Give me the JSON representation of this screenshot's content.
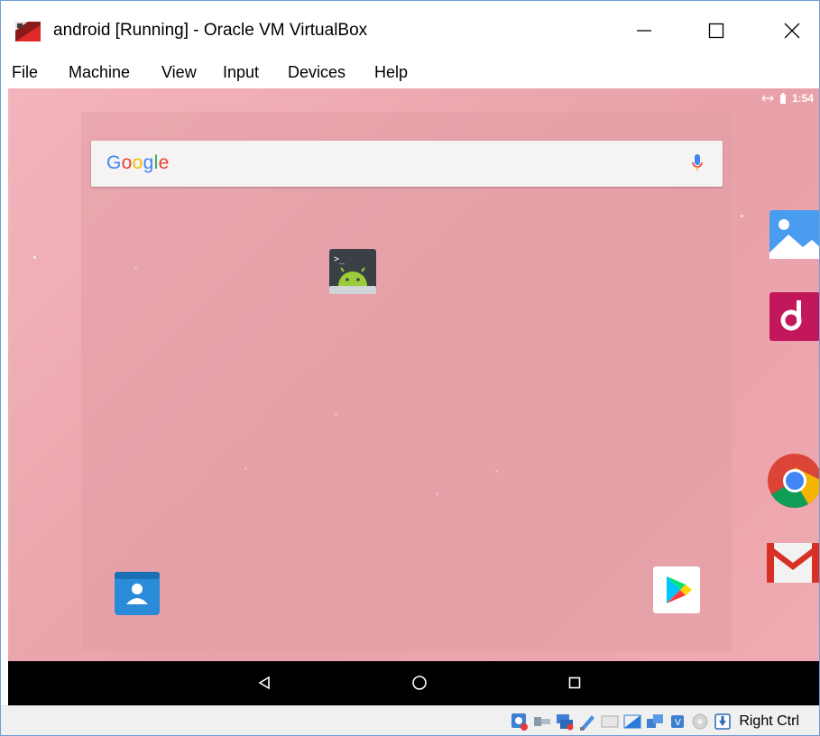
{
  "window": {
    "title": "android [Running] - Oracle VM VirtualBox",
    "minimize_glyph": "—",
    "maximize_glyph": "☐",
    "close_glyph": "✕"
  },
  "menu": {
    "items": [
      "File",
      "Machine",
      "View",
      "Input",
      "Devices",
      "Help"
    ]
  },
  "android": {
    "status_time": "1:54",
    "search_logo": "Google",
    "home_icons": [
      "terminal-emulator-icon",
      "contacts-icon",
      "play-store-icon"
    ],
    "side_icons": [
      "gallery-icon",
      "music-icon",
      "chrome-icon",
      "gmail-icon"
    ],
    "nav": [
      "back",
      "home",
      "recents"
    ]
  },
  "statusbar": {
    "host_key": "Right Ctrl",
    "tray_icons": [
      "optical-drive-icon",
      "usb-icon",
      "network-icon",
      "shared-folders-icon",
      "display-icon",
      "video-capture-icon",
      "mouse-integration-icon",
      "cpu-icon",
      "settings-icon",
      "host-key-arrow-icon"
    ]
  },
  "colors": {
    "accent_blue": "#4285f4",
    "google_red": "#ea4335",
    "google_yellow": "#fbbc05",
    "google_green": "#34a853",
    "screen_pink": "#eaa3ab"
  }
}
